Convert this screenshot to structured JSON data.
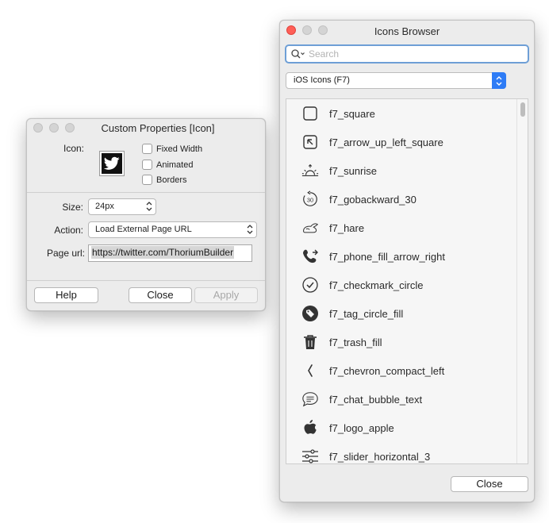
{
  "props_window": {
    "title": "Custom Properties [Icon]",
    "icon_label": "Icon:",
    "icon_preview": "twitter-bird-icon",
    "checkboxes": [
      {
        "label": "Fixed Width",
        "checked": false
      },
      {
        "label": "Animated",
        "checked": false
      },
      {
        "label": "Borders",
        "checked": false
      }
    ],
    "size_label": "Size:",
    "size_value": "24px",
    "action_label": "Action:",
    "action_value": "Load External Page URL",
    "url_label": "Page url:",
    "url_value": "https://twitter.com/ThoriumBuilder",
    "buttons": {
      "help": "Help",
      "close": "Close",
      "apply": "Apply"
    }
  },
  "browser_window": {
    "title": "Icons Browser",
    "search_placeholder": "Search",
    "library": "iOS Icons (F7)",
    "icons": [
      {
        "name": "f7_square",
        "icon": "square-icon"
      },
      {
        "name": "f7_arrow_up_left_square",
        "icon": "arrow-up-left-square-icon"
      },
      {
        "name": "f7_sunrise",
        "icon": "sunrise-icon"
      },
      {
        "name": "f7_gobackward_30",
        "icon": "gobackward-30-icon"
      },
      {
        "name": "f7_hare",
        "icon": "hare-icon"
      },
      {
        "name": "f7_phone_fill_arrow_right",
        "icon": "phone-fill-arrow-right-icon"
      },
      {
        "name": "f7_checkmark_circle",
        "icon": "checkmark-circle-icon"
      },
      {
        "name": "f7_tag_circle_fill",
        "icon": "tag-circle-fill-icon"
      },
      {
        "name": "f7_trash_fill",
        "icon": "trash-fill-icon"
      },
      {
        "name": "f7_chevron_compact_left",
        "icon": "chevron-compact-left-icon"
      },
      {
        "name": "f7_chat_bubble_text",
        "icon": "chat-bubble-text-icon"
      },
      {
        "name": "f7_logo_apple",
        "icon": "logo-apple-icon"
      },
      {
        "name": "f7_slider_horizontal_3",
        "icon": "slider-horizontal-3-icon"
      }
    ],
    "close_label": "Close"
  },
  "colors": {
    "accent": "#2e7cf6",
    "focus_ring": "#6e9fd6",
    "close_light": "#ff5f57"
  }
}
